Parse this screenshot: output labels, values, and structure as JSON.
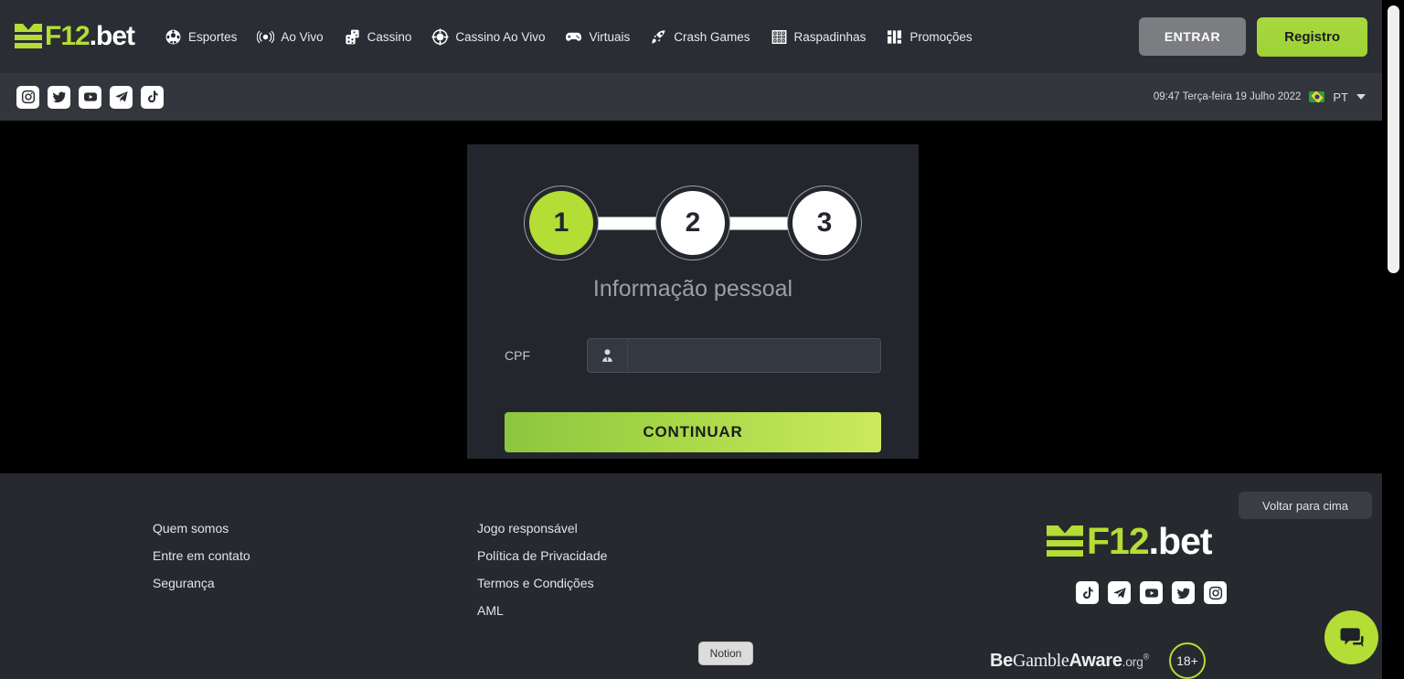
{
  "header": {
    "logo": {
      "green": "F12",
      "white": ".bet",
      "mark_icon": "f12-crown-mark"
    },
    "nav": [
      {
        "label": "Esportes",
        "icon": "soccer-ball-icon"
      },
      {
        "label": "Ao Vivo",
        "icon": "live-broadcast-icon"
      },
      {
        "label": "Cassino",
        "icon": "dice-icon"
      },
      {
        "label": "Cassino Ao Vivo",
        "icon": "casino-chip-icon"
      },
      {
        "label": "Virtuais",
        "icon": "gamepad-icon"
      },
      {
        "label": "Crash Games",
        "icon": "rocket-icon"
      },
      {
        "label": "Raspadinhas",
        "icon": "scratch-card-grid-icon"
      },
      {
        "label": "Promoções",
        "icon": "gift-icon"
      }
    ],
    "login_label": "ENTRAR",
    "register_label": "Registro"
  },
  "subheader": {
    "socials": [
      "instagram-icon",
      "twitter-icon",
      "youtube-icon",
      "telegram-icon",
      "tiktok-icon"
    ],
    "datetime": "09:47 Terça-feira 19 Julho 2022",
    "language": "PT",
    "flag_icon": "brazil-flag-icon",
    "chevron_icon": "chevron-down-icon"
  },
  "card": {
    "steps": [
      {
        "number": "1",
        "state": "active"
      },
      {
        "number": "2",
        "state": "inactive"
      },
      {
        "number": "3",
        "state": "inactive"
      }
    ],
    "title": "Informação pessoal",
    "field": {
      "label": "CPF",
      "value": "",
      "placeholder": "",
      "icon": "user-tie-icon"
    },
    "submit_label": "CONTINUAR"
  },
  "footer": {
    "column_one": [
      "Quem somos",
      "Entre em contato",
      "Segurança"
    ],
    "column_two": [
      "Jogo responsável",
      "Política de Privacidade",
      "Termos e Condições",
      "AML"
    ],
    "logo": {
      "green": "F12",
      "white": ".bet"
    },
    "socials": [
      "tiktok-icon",
      "telegram-icon",
      "youtube-icon",
      "twitter-icon",
      "instagram-icon"
    ],
    "gamble_aware": {
      "be": "Be",
      "gamble": "Gamble",
      "aware": "Aware",
      "org": ".org",
      "registered": "®"
    },
    "age_badge": "18+",
    "back_to_top": "Voltar para cima",
    "notion_label": "Notion",
    "chat_icon": "chat-bubble-icon"
  },
  "colors": {
    "brand_green": "#b4dd35",
    "header_bg": "#2a2d33",
    "subheader_bg": "#33363c",
    "card_bg": "#23262c",
    "footer_bg": "#26292e",
    "page_bg": "#000000"
  }
}
